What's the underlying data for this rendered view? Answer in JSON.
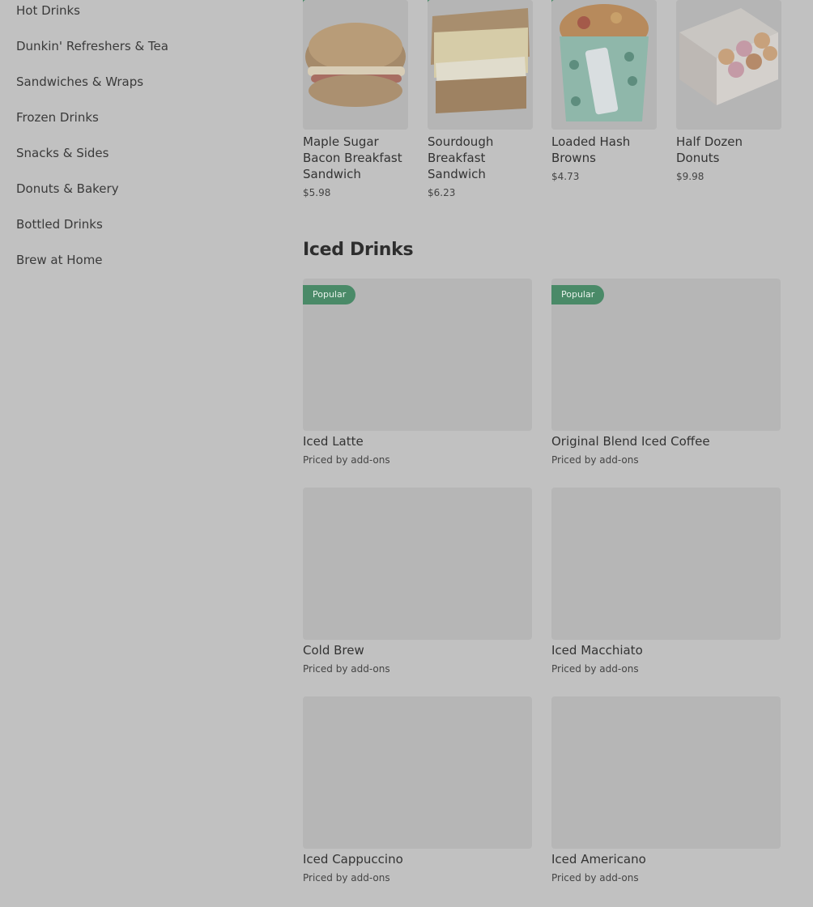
{
  "sidebar": {
    "items": [
      {
        "label": "Hot Drinks"
      },
      {
        "label": "Dunkin' Refreshers & Tea"
      },
      {
        "label": "Sandwiches & Wraps"
      },
      {
        "label": "Frozen Drinks"
      },
      {
        "label": "Snacks & Sides"
      },
      {
        "label": "Donuts & Bakery"
      },
      {
        "label": "Bottled Drinks"
      },
      {
        "label": "Brew at Home"
      }
    ]
  },
  "top_row": {
    "items": [
      {
        "name": "Maple Sugar Bacon Breakfast Sandwich",
        "price": "$5.98",
        "image": "croissant-sandwich"
      },
      {
        "name": "Sourdough Breakfast Sandwich",
        "price": "$6.23",
        "image": "sourdough-sandwich"
      },
      {
        "name": "Loaded Hash Browns",
        "price": "$4.73",
        "image": "hash-browns-cup"
      },
      {
        "name": "Half Dozen Donuts",
        "price": "$9.98",
        "image": "donut-box"
      }
    ]
  },
  "iced_drinks": {
    "title": "Iced Drinks",
    "items": [
      {
        "name": "Iced Latte",
        "price": "Priced by add-ons",
        "badge": "Popular"
      },
      {
        "name": "Original Blend Iced Coffee",
        "price": "Priced by add-ons",
        "badge": "Popular"
      },
      {
        "name": "Cold Brew",
        "price": "Priced by add-ons",
        "badge": ""
      },
      {
        "name": "Iced Macchiato",
        "price": "Priced by add-ons",
        "badge": ""
      },
      {
        "name": "Iced Cappuccino",
        "price": "Priced by add-ons",
        "badge": ""
      },
      {
        "name": "Iced Americano",
        "price": "Priced by add-ons",
        "badge": ""
      }
    ]
  },
  "colors": {
    "overlay_bg": "#c1c1c1",
    "badge": "#4a8a68",
    "placeholder": "#b6b6b6"
  }
}
